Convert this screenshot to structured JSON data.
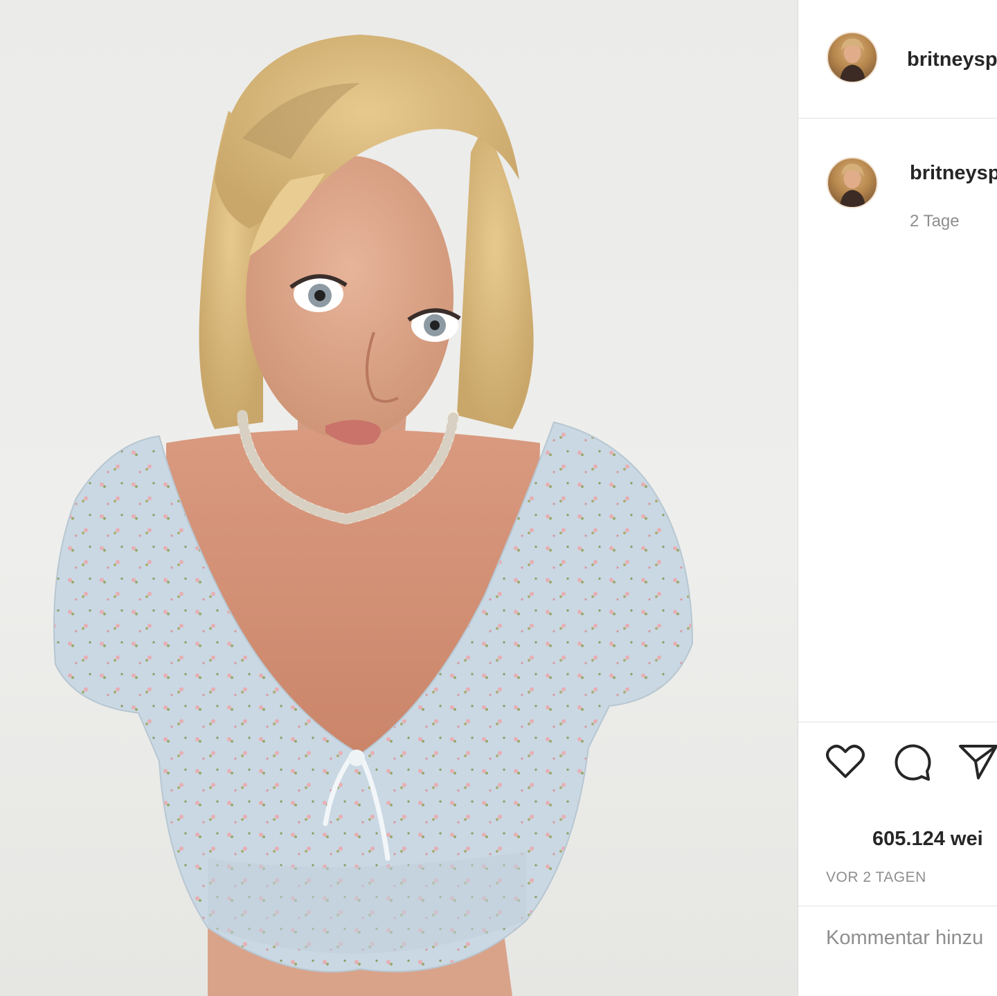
{
  "post": {
    "photo_icon": "photo-of-woman-in-floral-top"
  },
  "header": {
    "username": "britneysp",
    "avatar_icon": "profile-avatar"
  },
  "caption": {
    "username": "britneysp",
    "time": "2 Tage"
  },
  "actions": {
    "like_icon": "heart-icon",
    "comment_icon": "comment-bubble-icon",
    "share_icon": "paper-plane-icon"
  },
  "likes": {
    "text": "605.124 wei"
  },
  "timestamp": {
    "text": "VOR 2 TAGEN"
  },
  "comment": {
    "placeholder": "Kommentar hinzu"
  },
  "colors": {
    "text_primary": "#262626",
    "text_secondary": "#8e8e8e",
    "divider": "#efefef"
  }
}
